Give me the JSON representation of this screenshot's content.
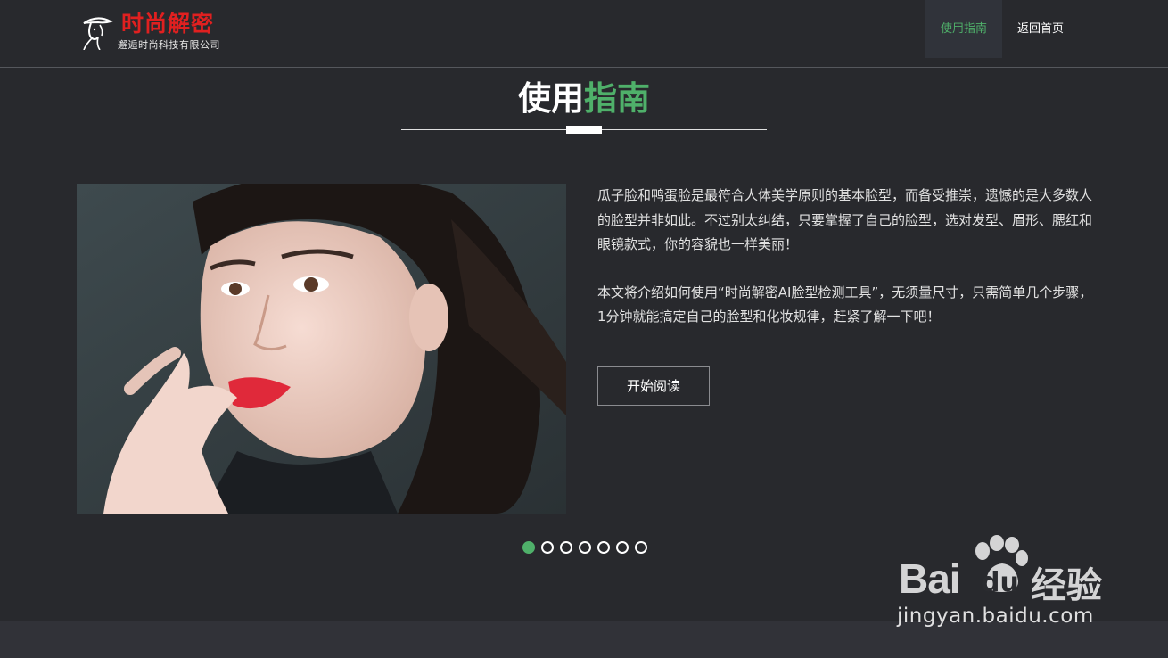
{
  "nav": {
    "logo_brand": "时尚解密",
    "logo_company": "邂逅时尚科技有限公司",
    "items": [
      {
        "label": "使用指南",
        "active": true
      },
      {
        "label": "返回首页",
        "active": false
      }
    ]
  },
  "section": {
    "title_white": "使用",
    "title_green": "指南"
  },
  "slide": {
    "paragraphs": [
      "瓜子脸和鸭蛋脸是最符合人体美学原则的基本脸型，而备受推崇，遗憾的是大多数人的脸型并非如此。不过别太纠结，只要掌握了自己的脸型，选对发型、眉形、腮红和眼镜款式，你的容貌也一样美丽！",
      "本文将介绍如何使用“时尚解密AI脸型检测工具”，无须量尺寸，只需简单几个步骤，1分钟就能搞定自己的脸型和化妆规律，赶紧了解一下吧！"
    ],
    "button_label": "开始阅读",
    "total_slides": 7,
    "active_slide": 1
  },
  "watermark": {
    "brand_latin": "Bai",
    "brand_du": "du",
    "brand_cn": "经验",
    "url": "jingyan.baidu.com"
  },
  "colors": {
    "background": "#28292d",
    "accent_green": "#4fb06a",
    "brand_red": "#e02020",
    "active_nav_bg": "#30333a"
  }
}
